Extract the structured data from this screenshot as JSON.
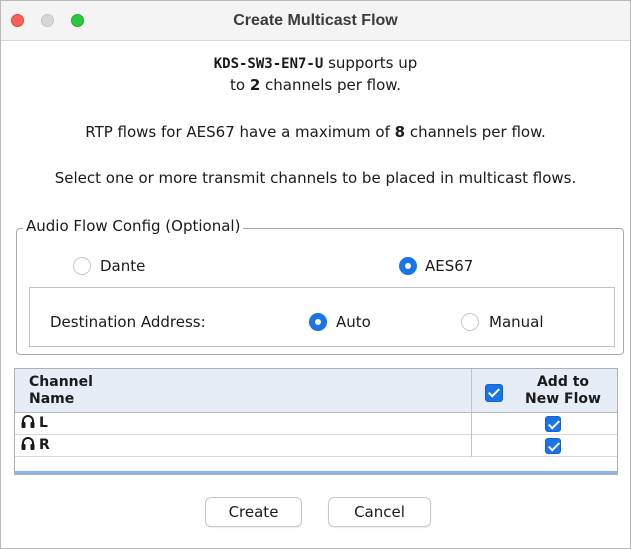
{
  "window": {
    "title": "Create Multicast Flow",
    "traffic_lights": {
      "close": "#fe5f57",
      "minimize": "#d7d7d7",
      "maximize": "#2ac840"
    }
  },
  "info": {
    "device_name": "KDS-SW3-EN7-U",
    "line1_suffix": " supports up",
    "line2_prefix": "to ",
    "line2_number": "2",
    "line2_suffix": " channels per flow.",
    "rtp_prefix": "RTP flows for AES67 have a maximum of ",
    "rtp_number": "8",
    "rtp_suffix": " channels per flow.",
    "select_text": "Select one or more transmit channels to be placed in multicast flows."
  },
  "audio_flow_config": {
    "legend": "Audio Flow Config (Optional)",
    "options": [
      {
        "label": "Dante",
        "selected": false
      },
      {
        "label": "AES67",
        "selected": true
      }
    ],
    "destination": {
      "label": "Destination Address:",
      "options": [
        {
          "label": "Auto",
          "selected": true
        },
        {
          "label": "Manual",
          "selected": false
        }
      ]
    }
  },
  "table": {
    "header_channel_line1": "Channel",
    "header_channel_line2": "Name",
    "header_add_line1": "Add to",
    "header_add_line2": "New Flow",
    "header_all_checked": true,
    "rows": [
      {
        "name": "L",
        "icon": "headphones-icon",
        "checked": true
      },
      {
        "name": "R",
        "icon": "headphones-icon",
        "checked": true
      }
    ]
  },
  "buttons": {
    "create": "Create",
    "cancel": "Cancel"
  },
  "colors": {
    "accent": "#1a74e8",
    "table_header_bg": "#e6edf7"
  }
}
